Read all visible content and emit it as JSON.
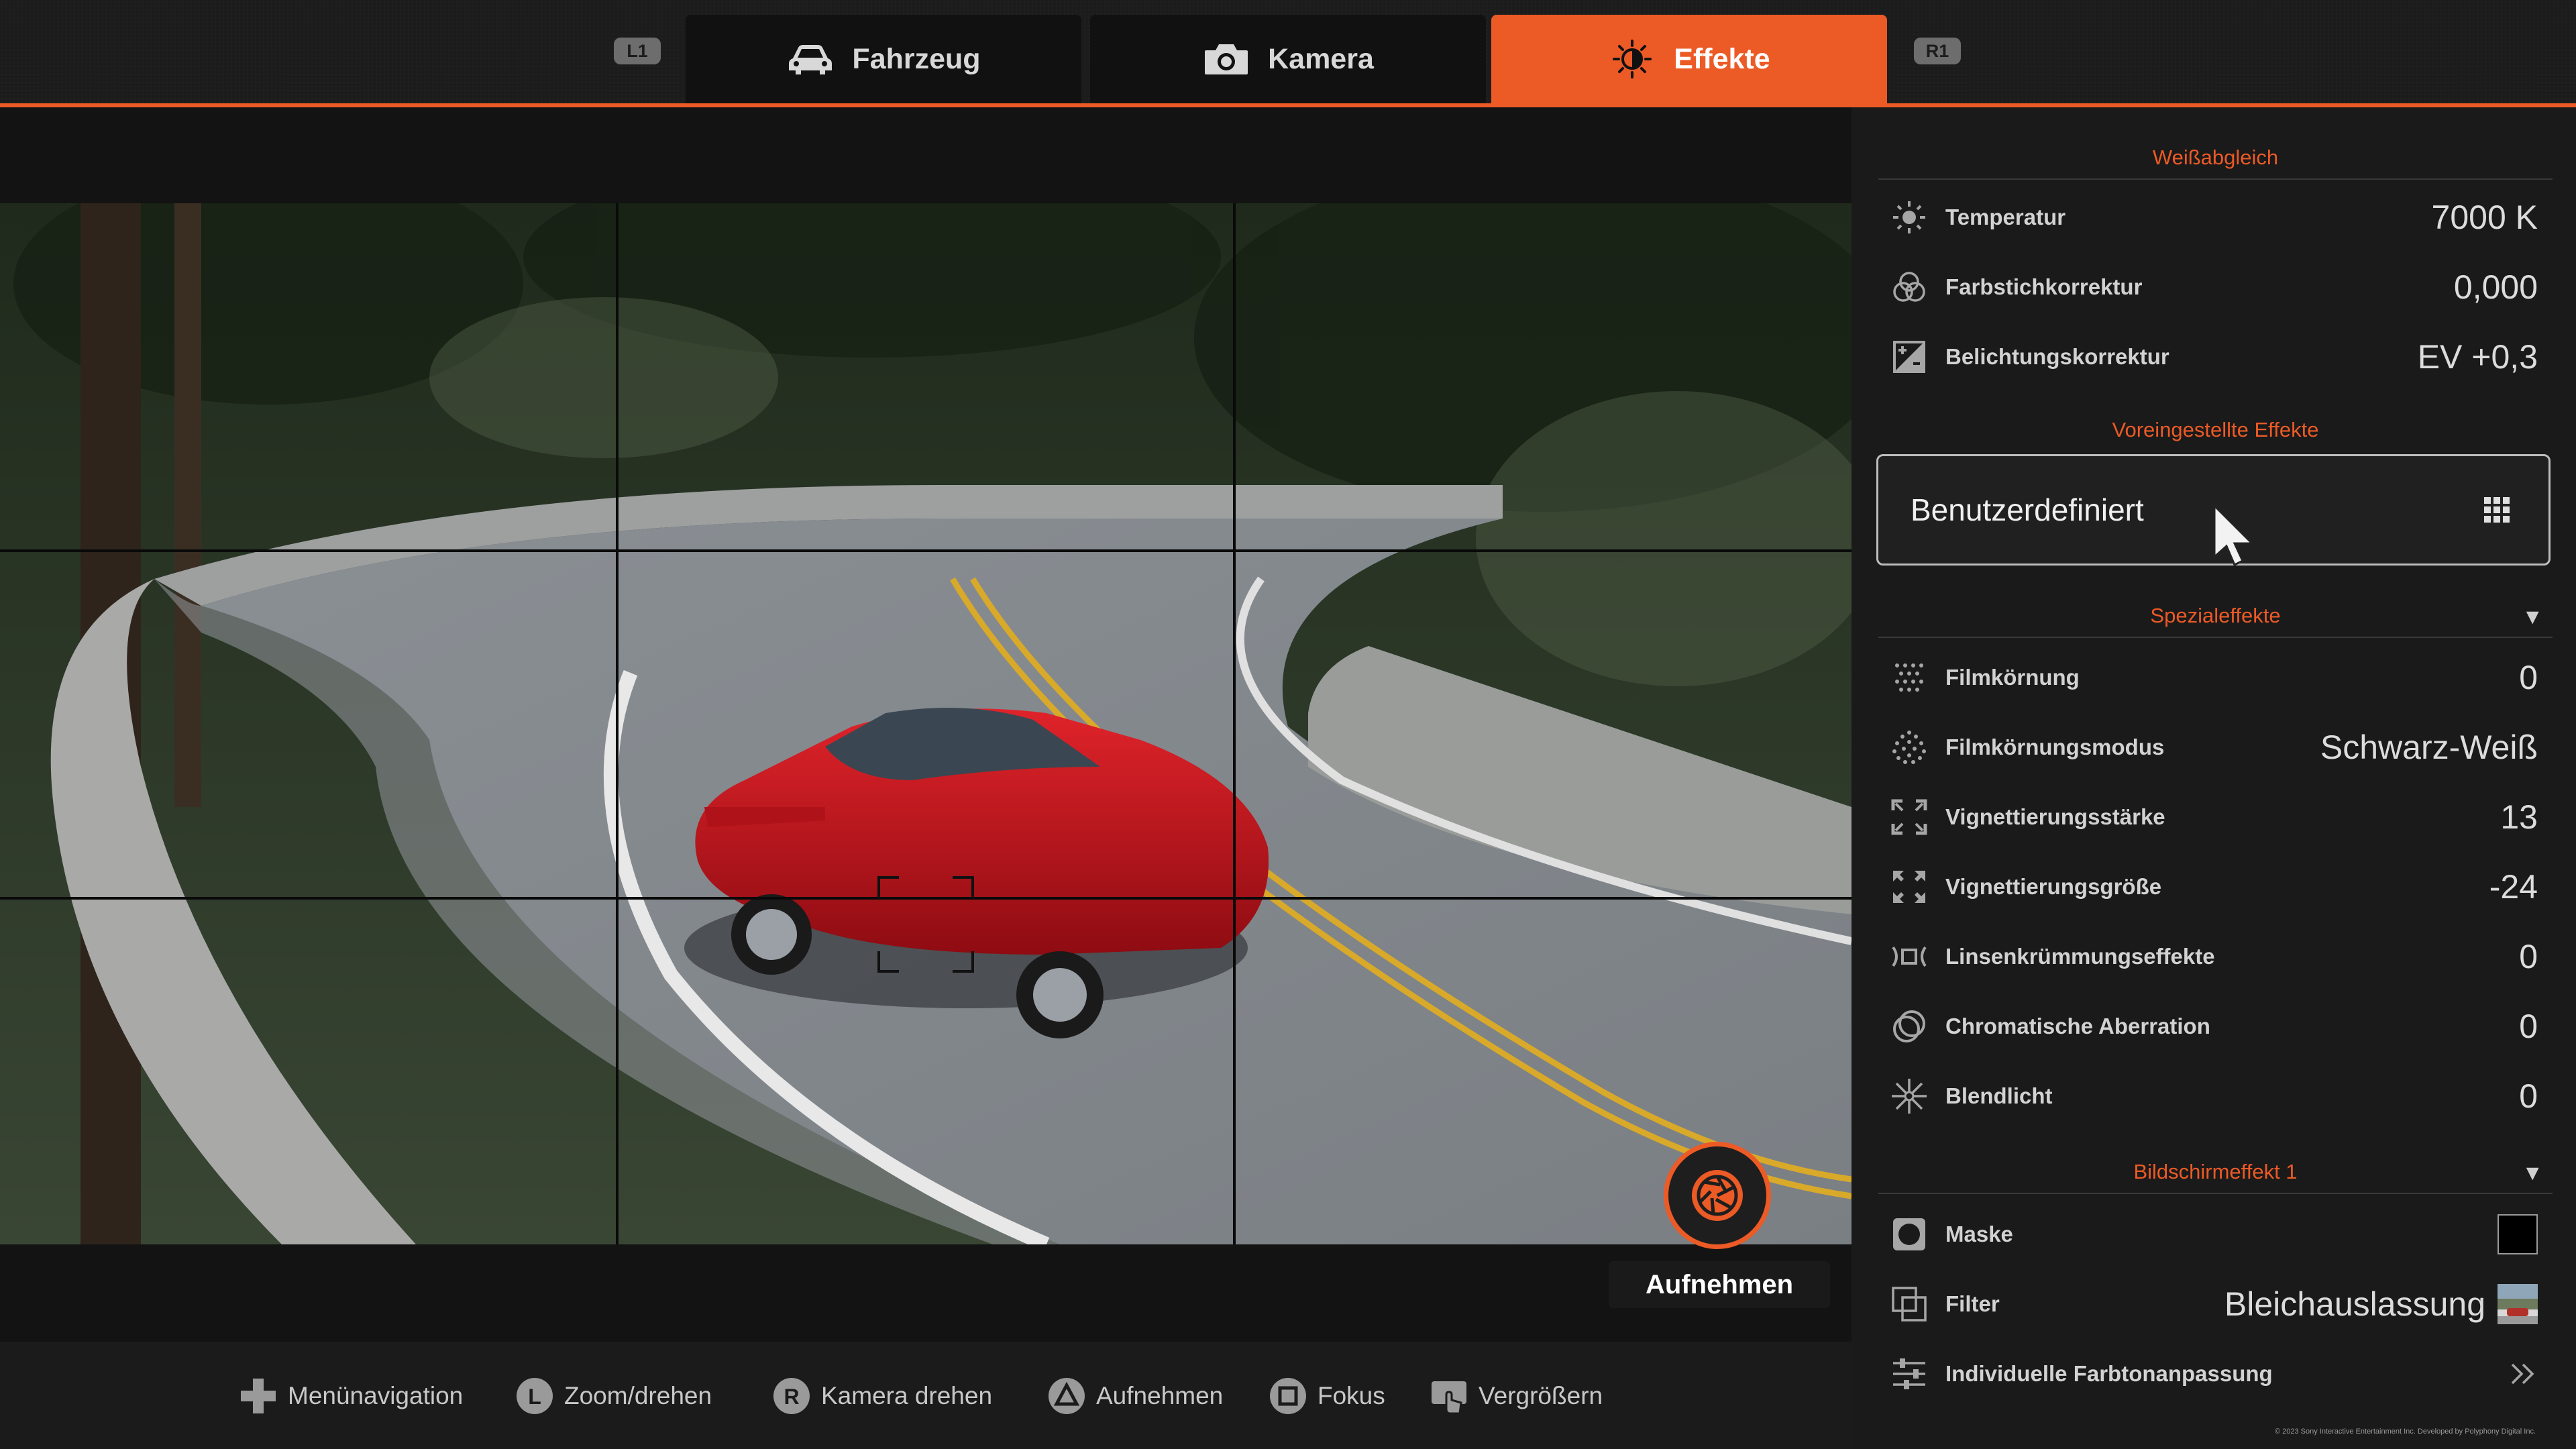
{
  "tabs": {
    "l1": "L1",
    "r1": "R1",
    "items": [
      {
        "label": "Fahrzeug",
        "icon": "car-icon"
      },
      {
        "label": "Kamera",
        "icon": "camera-icon"
      },
      {
        "label": "Effekte",
        "icon": "brightness-icon",
        "active": true
      }
    ]
  },
  "capture": {
    "label": "Aufnehmen",
    "icon": "shutter-icon"
  },
  "hints": [
    {
      "icon": "dpad-icon",
      "label": "Menünavigation"
    },
    {
      "icon": "left-stick-icon",
      "label": "Zoom/drehen"
    },
    {
      "icon": "right-stick-icon",
      "label": "Kamera drehen"
    },
    {
      "icon": "triangle-button-icon",
      "label": "Aufnehmen"
    },
    {
      "icon": "square-button-icon",
      "label": "Fokus"
    },
    {
      "icon": "touchpad-icon",
      "label": "Vergrößern"
    }
  ],
  "panel": {
    "white_balance": {
      "title": "Weißabgleich",
      "rows": [
        {
          "icon": "sun-icon",
          "label": "Temperatur",
          "value": "7000 K"
        },
        {
          "icon": "color-circles-icon",
          "label": "Farbstichkorrektur",
          "value": "0,000"
        },
        {
          "icon": "exposure-icon",
          "label": "Belichtungskorrektur",
          "value": "EV +0,3"
        }
      ]
    },
    "presets": {
      "title": "Voreingestellte Effekte",
      "value": "Benutzerdefiniert",
      "icon": "grid-menu-icon"
    },
    "special": {
      "title": "Spezialeffekte",
      "rows": [
        {
          "icon": "grain-icon",
          "label": "Filmkörnung",
          "value": "0"
        },
        {
          "icon": "grain-mode-icon",
          "label": "Filmkörnungsmodus",
          "value": "Schwarz-Weiß"
        },
        {
          "icon": "vignette-strength-icon",
          "label": "Vignettierungsstärke",
          "value": "13"
        },
        {
          "icon": "vignette-size-icon",
          "label": "Vignettierungsgröße",
          "value": "-24"
        },
        {
          "icon": "lens-distortion-icon",
          "label": "Linsenkrümmungseffekte",
          "value": "0"
        },
        {
          "icon": "chromatic-icon",
          "label": "Chromatische Aberration",
          "value": "0"
        },
        {
          "icon": "flare-icon",
          "label": "Blendlicht",
          "value": "0"
        }
      ]
    },
    "screen1": {
      "title": "Bildschirmeffekt 1",
      "rows": [
        {
          "icon": "mask-icon",
          "label": "Maske",
          "value": ""
        },
        {
          "icon": "filter-icon",
          "label": "Filter",
          "value": "Bleichauslassung"
        },
        {
          "icon": "sliders-icon",
          "label": "Individuelle Farbtonanpassung",
          "value": ""
        }
      ]
    },
    "copyright": "© 2023 Sony Interactive Entertainment Inc. Developed by Polyphony Digital Inc."
  },
  "colors": {
    "accent": "#ec5a26",
    "panel": "#1a1a1a",
    "car": "#c8141b"
  }
}
